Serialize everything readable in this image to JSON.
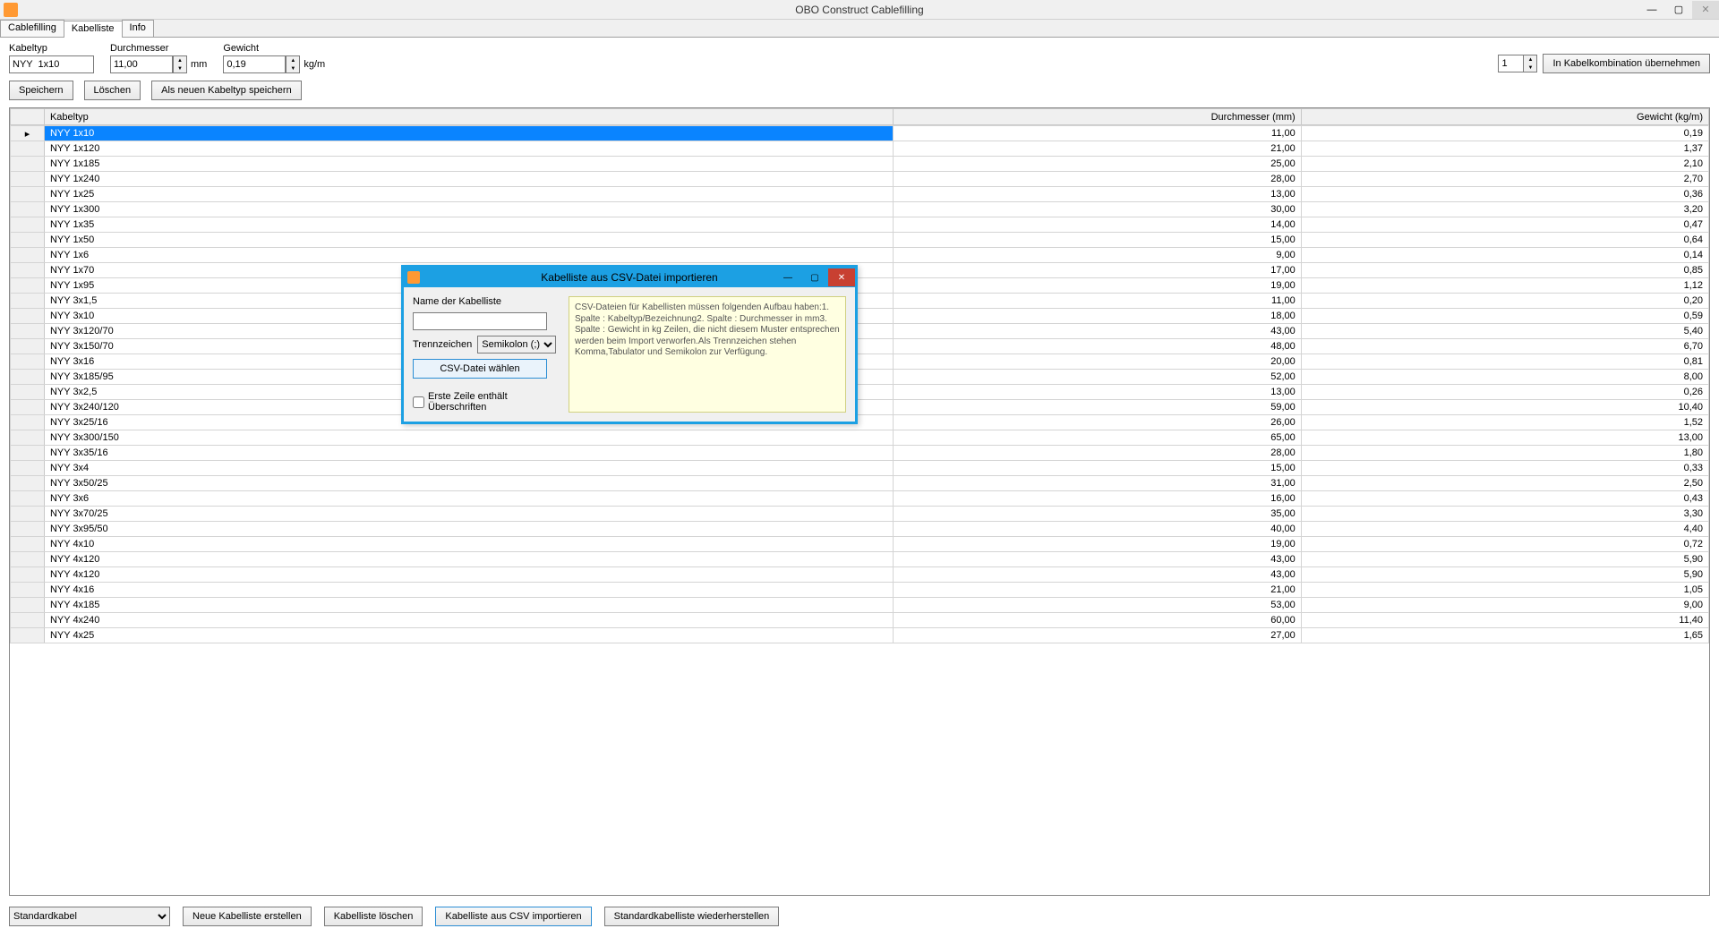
{
  "app": {
    "title": "OBO Construct Cablefilling"
  },
  "tabs": [
    {
      "label": "Cablefilling",
      "active": false
    },
    {
      "label": "Kabelliste",
      "active": true
    },
    {
      "label": "Info",
      "active": false
    }
  ],
  "form": {
    "kabeltyp_label": "Kabeltyp",
    "kabeltyp_value": "NYY  1x10",
    "durchmesser_label": "Durchmesser",
    "durchmesser_value": "11,00",
    "durchmesser_unit": "mm",
    "gewicht_label": "Gewicht",
    "gewicht_value": "0,19",
    "gewicht_unit": "kg/m",
    "qty_value": "1",
    "add_button": "In Kabelkombination übernehmen"
  },
  "buttons": {
    "save": "Speichern",
    "delete": "Löschen",
    "save_as_new": "Als neuen Kabeltyp speichern"
  },
  "table": {
    "headers": {
      "type": "Kabeltyp",
      "diameter": "Durchmesser (mm)",
      "weight": "Gewicht (kg/m)"
    },
    "rows": [
      {
        "type": "NYY  1x10",
        "diameter": "11,00",
        "weight": "0,19",
        "selected": true
      },
      {
        "type": "NYY  1x120",
        "diameter": "21,00",
        "weight": "1,37"
      },
      {
        "type": "NYY  1x185",
        "diameter": "25,00",
        "weight": "2,10"
      },
      {
        "type": "NYY  1x240",
        "diameter": "28,00",
        "weight": "2,70"
      },
      {
        "type": "NYY  1x25",
        "diameter": "13,00",
        "weight": "0,36"
      },
      {
        "type": "NYY  1x300",
        "diameter": "30,00",
        "weight": "3,20"
      },
      {
        "type": "NYY  1x35",
        "diameter": "14,00",
        "weight": "0,47"
      },
      {
        "type": "NYY  1x50",
        "diameter": "15,00",
        "weight": "0,64"
      },
      {
        "type": "NYY  1x6",
        "diameter": "9,00",
        "weight": "0,14"
      },
      {
        "type": "NYY  1x70",
        "diameter": "17,00",
        "weight": "0,85"
      },
      {
        "type": "NYY  1x95",
        "diameter": "19,00",
        "weight": "1,12"
      },
      {
        "type": "NYY  3x1,5",
        "diameter": "11,00",
        "weight": "0,20"
      },
      {
        "type": "NYY  3x10",
        "diameter": "18,00",
        "weight": "0,59"
      },
      {
        "type": "NYY  3x120/70",
        "diameter": "43,00",
        "weight": "5,40"
      },
      {
        "type": "NYY  3x150/70",
        "diameter": "48,00",
        "weight": "6,70"
      },
      {
        "type": "NYY  3x16",
        "diameter": "20,00",
        "weight": "0,81"
      },
      {
        "type": "NYY  3x185/95",
        "diameter": "52,00",
        "weight": "8,00"
      },
      {
        "type": "NYY  3x2,5",
        "diameter": "13,00",
        "weight": "0,26"
      },
      {
        "type": "NYY  3x240/120",
        "diameter": "59,00",
        "weight": "10,40"
      },
      {
        "type": "NYY  3x25/16",
        "diameter": "26,00",
        "weight": "1,52"
      },
      {
        "type": "NYY  3x300/150",
        "diameter": "65,00",
        "weight": "13,00"
      },
      {
        "type": "NYY  3x35/16",
        "diameter": "28,00",
        "weight": "1,80"
      },
      {
        "type": "NYY  3x4",
        "diameter": "15,00",
        "weight": "0,33"
      },
      {
        "type": "NYY  3x50/25",
        "diameter": "31,00",
        "weight": "2,50"
      },
      {
        "type": "NYY  3x6",
        "diameter": "16,00",
        "weight": "0,43"
      },
      {
        "type": "NYY  3x70/25",
        "diameter": "35,00",
        "weight": "3,30"
      },
      {
        "type": "NYY  3x95/50",
        "diameter": "40,00",
        "weight": "4,40"
      },
      {
        "type": "NYY  4x10",
        "diameter": "19,00",
        "weight": "0,72"
      },
      {
        "type": "NYY  4x120",
        "diameter": "43,00",
        "weight": "5,90"
      },
      {
        "type": "NYY  4x120",
        "diameter": "43,00",
        "weight": "5,90"
      },
      {
        "type": "NYY  4x16",
        "diameter": "21,00",
        "weight": "1,05"
      },
      {
        "type": "NYY  4x185",
        "diameter": "53,00",
        "weight": "9,00"
      },
      {
        "type": "NYY  4x240",
        "diameter": "60,00",
        "weight": "11,40"
      },
      {
        "type": "NYY  4x25",
        "diameter": "27,00",
        "weight": "1,65"
      }
    ]
  },
  "bottom": {
    "list_selector_value": "Standardkabel",
    "new_list": "Neue Kabelliste erstellen",
    "delete_list": "Kabelliste löschen",
    "import_csv": "Kabelliste aus CSV importieren",
    "restore_default": "Standardkabelliste wiederherstellen"
  },
  "dialog": {
    "title": "Kabelliste aus CSV-Datei importieren",
    "name_label": "Name der Kabelliste",
    "name_value": "",
    "separator_label": "Trennzeichen",
    "separator_value": "Semikolon (;)",
    "choose_csv": "CSV-Datei wählen",
    "first_row_headers": "Erste Zeile enthält Überschriften",
    "help_text": "CSV-Dateien für Kabellisten müssen folgenden Aufbau haben:1. Spalte : Kabeltyp/Bezeichnung2. Spalte : Durchmesser in mm3. Spalte : Gewicht in kg Zeilen, die nicht diesem Muster entsprechen werden beim Import verworfen.Als Trennzeichen stehen Komma,Tabulator und Semikolon zur Verfügung."
  }
}
